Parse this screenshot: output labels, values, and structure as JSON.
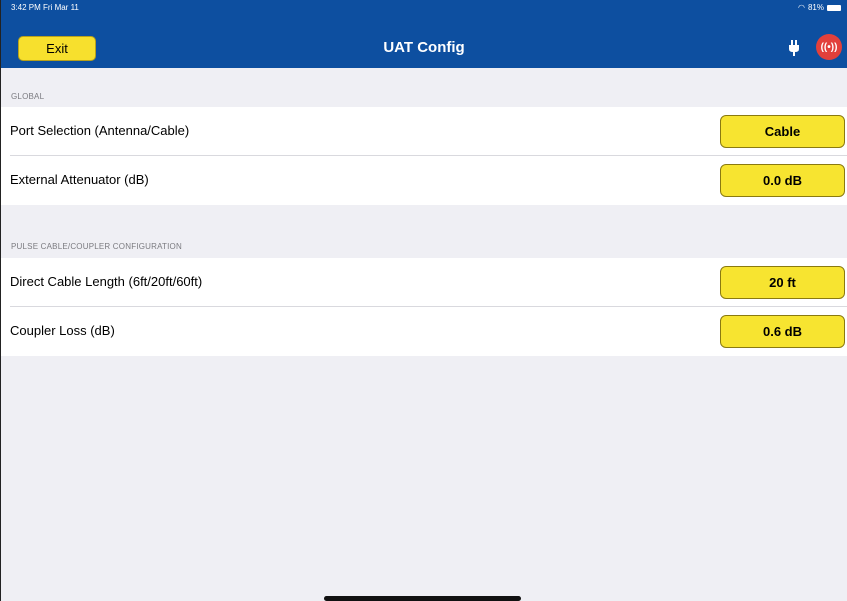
{
  "status_bar": {
    "time": "3:42 PM  Fri Mar 11",
    "battery": "81%"
  },
  "nav": {
    "exit_label": "Exit",
    "title": "UAT Config",
    "broadcast_glyph": "((•))"
  },
  "sections": {
    "global": {
      "header": "GLOBAL",
      "rows": [
        {
          "label": "Port Selection (Antenna/Cable)",
          "value": "Cable"
        },
        {
          "label": "External Attenuator (dB)",
          "value": "0.0 dB"
        }
      ]
    },
    "pulse": {
      "header": "PULSE CABLE/COUPLER CONFIGURATION",
      "rows": [
        {
          "label": "Direct Cable Length (6ft/20ft/60ft)",
          "value": "20 ft"
        },
        {
          "label": "Coupler Loss (dB)",
          "value": "0.6 dB"
        }
      ]
    }
  },
  "colors": {
    "nav_bar": "#0d4fa0",
    "button_yellow": "#f7e430",
    "broadcast_red": "#e2403b",
    "background": "#efeff4"
  },
  "icons": [
    "plug-icon",
    "broadcast-icon",
    "wifi-icon",
    "battery-icon"
  ]
}
